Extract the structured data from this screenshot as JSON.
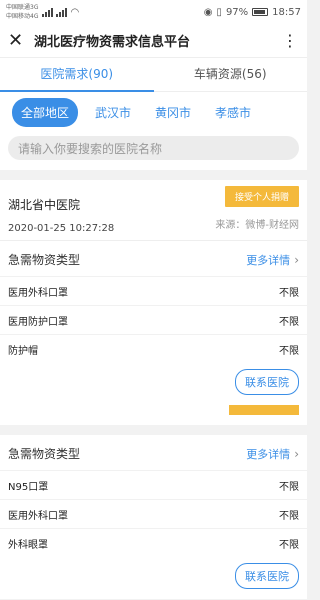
{
  "status_bar": {
    "carrier1": "中国联通3G",
    "carrier2": "中国移动4G",
    "battery": "97%",
    "time": "18:57"
  },
  "header": {
    "title": "湖北医疗物资需求信息平台"
  },
  "tabs": [
    {
      "label": "医院需求(90)",
      "active": true
    },
    {
      "label": "车辆资源(56)",
      "active": false
    }
  ],
  "regions": [
    {
      "label": "全部地区",
      "active": true
    },
    {
      "label": "武汉市",
      "active": false
    },
    {
      "label": "黄冈市",
      "active": false
    },
    {
      "label": "孝感市",
      "active": false
    }
  ],
  "search": {
    "placeholder": "请输入你要搜索的医院名称"
  },
  "cards": [
    {
      "hospital": "湖北省中医院",
      "date": "2020-01-25 10:27:28",
      "badge": "接受个人捐赠",
      "source": "来源：微博-财经网",
      "section_title": "急需物资类型",
      "more": "更多详情",
      "items": [
        {
          "name": "医用外科口罩",
          "qty": "不限"
        },
        {
          "name": "医用防护口罩",
          "qty": "不限"
        },
        {
          "name": "防护帽",
          "qty": "不限"
        }
      ],
      "contact": "联系医院"
    },
    {
      "section_title": "急需物资类型",
      "more": "更多详情",
      "items": [
        {
          "name": "N95口罩",
          "qty": "不限"
        },
        {
          "name": "医用外科口罩",
          "qty": "不限"
        },
        {
          "name": "外科眼罩",
          "qty": "不限"
        }
      ],
      "contact": "联系医院"
    }
  ],
  "icons": {
    "close": "close-icon",
    "more": "more-icon",
    "chevron": "chevron-right-icon"
  },
  "colors": {
    "accent": "#3a8ee6",
    "badge": "#f4b93b"
  }
}
